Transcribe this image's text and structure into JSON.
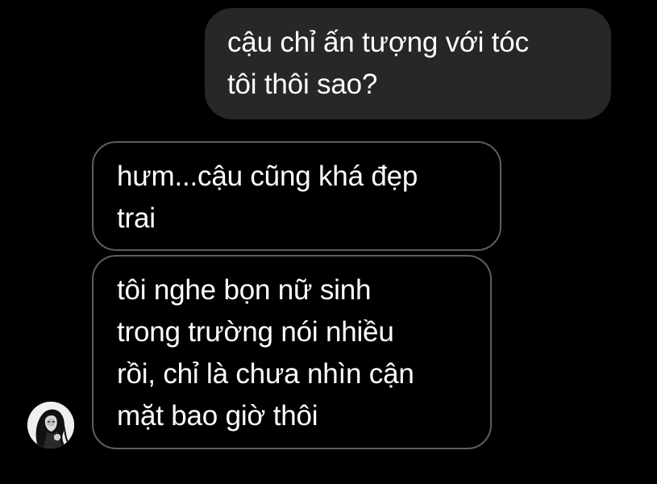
{
  "conversation": {
    "messages": [
      {
        "sender": "me",
        "lines": [
          "cậu chỉ ấn tượng với tóc",
          "tôi thôi sao?"
        ]
      },
      {
        "sender": "them",
        "lines": [
          "hưm...cậu cũng khá đẹp",
          "trai"
        ]
      },
      {
        "sender": "them",
        "lines": [
          "tôi nghe bọn nữ sinh",
          "trong trường nói nhiều",
          "rồi, chỉ là chưa nhìn cận",
          "mặt bao giờ thôi"
        ]
      }
    ]
  },
  "colors": {
    "background": "#000000",
    "outgoing_bubble": "#27272a",
    "incoming_border": "#5e5e60",
    "text": "#ffffff"
  },
  "icons": {
    "avatar": "contact-avatar-icon"
  }
}
